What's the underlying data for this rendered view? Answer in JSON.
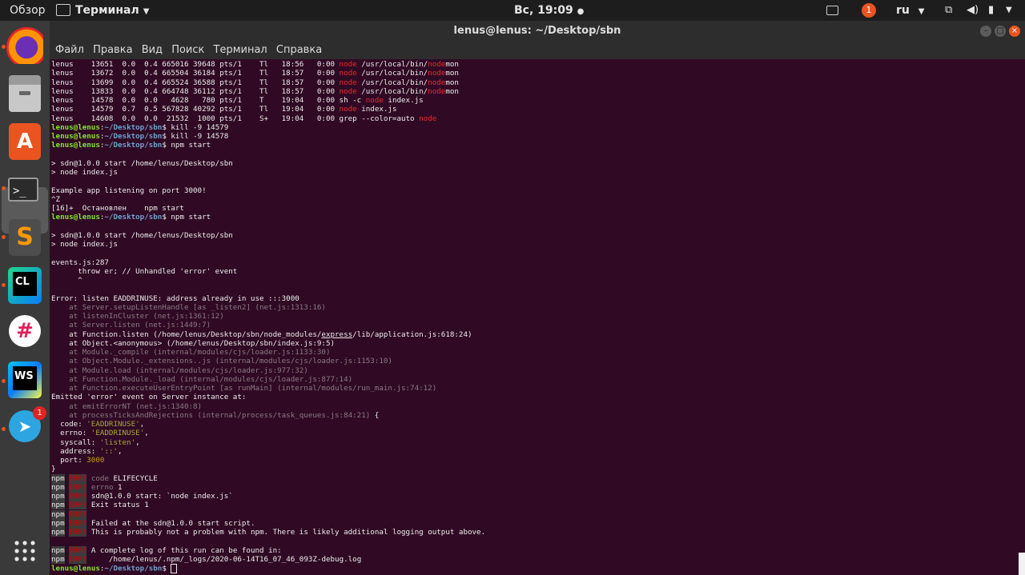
{
  "topbar": {
    "activities": "Обзор",
    "app_menu": "Терминал",
    "clock": "Вс, 19:09",
    "language": "ru"
  },
  "dock": {
    "apps": [
      {
        "name": "firefox-icon",
        "running": true
      },
      {
        "name": "files-icon",
        "running": false
      },
      {
        "name": "software-center-icon",
        "running": false
      },
      {
        "name": "terminal-icon",
        "running": true
      },
      {
        "name": "sublime-text-icon",
        "running": true
      },
      {
        "name": "clion-icon",
        "running": true
      },
      {
        "name": "slack-icon",
        "running": false
      },
      {
        "name": "webstorm-icon",
        "running": true
      },
      {
        "name": "telegram-icon",
        "running": true,
        "badge": "1"
      }
    ],
    "show_apps": "show-applications-icon"
  },
  "window": {
    "title": "lenus@lenus: ~/Desktop/sbn",
    "menu": [
      "Файл",
      "Правка",
      "Вид",
      "Поиск",
      "Терминал",
      "Справка"
    ]
  },
  "terminal": {
    "lines": [
      [
        {
          "t": "lenus    13651  0.0  0.4 665016 39648 pts/1    Tl   18:56   0:00 "
        },
        {
          "t": "node",
          "c": "red"
        },
        {
          "t": " /usr/local/bin/"
        },
        {
          "t": "node",
          "c": "red"
        },
        {
          "t": "mon"
        }
      ],
      [
        {
          "t": "lenus    13672  0.0  0.4 665504 36184 pts/1    Tl   18:57   0:00 "
        },
        {
          "t": "node",
          "c": "red"
        },
        {
          "t": " /usr/local/bin/"
        },
        {
          "t": "node",
          "c": "red"
        },
        {
          "t": "mon"
        }
      ],
      [
        {
          "t": "lenus    13699  0.0  0.4 665524 36588 pts/1    Tl   18:57   0:00 "
        },
        {
          "t": "node",
          "c": "red"
        },
        {
          "t": " /usr/local/bin/"
        },
        {
          "t": "node",
          "c": "red"
        },
        {
          "t": "mon"
        }
      ],
      [
        {
          "t": "lenus    13833  0.0  0.4 664748 36112 pts/1    Tl   18:57   0:00 "
        },
        {
          "t": "node",
          "c": "red"
        },
        {
          "t": " /usr/local/bin/"
        },
        {
          "t": "node",
          "c": "red"
        },
        {
          "t": "mon"
        }
      ],
      [
        {
          "t": "lenus    14578  0.0  0.0   4628   780 pts/1    T    19:04   0:00 sh -c "
        },
        {
          "t": "node",
          "c": "red"
        },
        {
          "t": " index.js"
        }
      ],
      [
        {
          "t": "lenus    14579  0.7  0.5 567828 40292 pts/1    Tl   19:04   0:00 "
        },
        {
          "t": "node",
          "c": "red"
        },
        {
          "t": " index.js"
        }
      ],
      [
        {
          "t": "lenus    14608  0.0  0.0  21532  1000 pts/1    S+   19:04   0:00 grep --color=auto "
        },
        {
          "t": "node",
          "c": "red"
        }
      ],
      [
        {
          "t": "lenus@lenus",
          "c": "prompt"
        },
        {
          "t": ":"
        },
        {
          "t": "~/Desktop/sbn",
          "c": "path"
        },
        {
          "t": "$ kill -9 14579"
        }
      ],
      [
        {
          "t": "lenus@lenus",
          "c": "prompt"
        },
        {
          "t": ":"
        },
        {
          "t": "~/Desktop/sbn",
          "c": "path"
        },
        {
          "t": "$ kill -9 14578"
        }
      ],
      [
        {
          "t": "lenus@lenus",
          "c": "prompt"
        },
        {
          "t": ":"
        },
        {
          "t": "~/Desktop/sbn",
          "c": "path"
        },
        {
          "t": "$ npm start"
        }
      ],
      [
        {
          "t": ""
        }
      ],
      [
        {
          "t": "> sdn@1.0.0 start /home/lenus/Desktop/sbn"
        }
      ],
      [
        {
          "t": "> node index.js"
        }
      ],
      [
        {
          "t": ""
        }
      ],
      [
        {
          "t": "Example app listening on port 3000!"
        }
      ],
      [
        {
          "t": "^Z"
        }
      ],
      [
        {
          "t": "[16]+  Остановлен    npm start"
        }
      ],
      [
        {
          "t": "lenus@lenus",
          "c": "prompt"
        },
        {
          "t": ":"
        },
        {
          "t": "~/Desktop/sbn",
          "c": "path"
        },
        {
          "t": "$ npm start"
        }
      ],
      [
        {
          "t": ""
        }
      ],
      [
        {
          "t": "> sdn@1.0.0 start /home/lenus/Desktop/sbn"
        }
      ],
      [
        {
          "t": "> node index.js"
        }
      ],
      [
        {
          "t": ""
        }
      ],
      [
        {
          "t": "events.js:287"
        }
      ],
      [
        {
          "t": "      throw er; // Unhandled 'error' event"
        }
      ],
      [
        {
          "t": "      ^"
        }
      ],
      [
        {
          "t": ""
        }
      ],
      [
        {
          "t": "Error: listen EADDRINUSE: address already in use :::3000"
        }
      ],
      [
        {
          "t": "    at Server.setupListenHandle [as _listen2] (net.js:1313:16)",
          "c": "dim"
        }
      ],
      [
        {
          "t": "    at listenInCluster (net.js:1361:12)",
          "c": "dim"
        }
      ],
      [
        {
          "t": "    at Server.listen (net.js:1449:7)",
          "c": "dim"
        }
      ],
      [
        {
          "t": "    at Function.listen (/home/lenus/Desktop/sbn/node_modules/"
        },
        {
          "t": "express",
          "c": "u"
        },
        {
          "t": "/lib/application.js:618:24)"
        }
      ],
      [
        {
          "t": "    at Object.<anonymous> (/home/lenus/Desktop/sbn/index.js:9:5)"
        }
      ],
      [
        {
          "t": "    at Module._compile (internal/modules/cjs/loader.js:1133:30)",
          "c": "dim"
        }
      ],
      [
        {
          "t": "    at Object.Module._extensions..js (internal/modules/cjs/loader.js:1153:10)",
          "c": "dim"
        }
      ],
      [
        {
          "t": "    at Module.load (internal/modules/cjs/loader.js:977:32)",
          "c": "dim"
        }
      ],
      [
        {
          "t": "    at Function.Module._load (internal/modules/cjs/loader.js:877:14)",
          "c": "dim"
        }
      ],
      [
        {
          "t": "    at Function.executeUserEntryPoint [as runMain] (internal/modules/run_main.js:74:12)",
          "c": "dim"
        }
      ],
      [
        {
          "t": "Emitted 'error' event on Server instance at:"
        }
      ],
      [
        {
          "t": "    at emitErrorNT (net.js:1340:8)",
          "c": "dim"
        }
      ],
      [
        {
          "t": "    at processTicksAndRejections (internal/process/task_queues.js:84:21)",
          "c": "dim"
        },
        {
          "t": " {"
        }
      ],
      [
        {
          "t": "  code: "
        },
        {
          "t": "'EADDRINUSE'",
          "c": "green"
        },
        {
          "t": ","
        }
      ],
      [
        {
          "t": "  errno: "
        },
        {
          "t": "'EADDRINUSE'",
          "c": "green"
        },
        {
          "t": ","
        }
      ],
      [
        {
          "t": "  syscall: "
        },
        {
          "t": "'listen'",
          "c": "green"
        },
        {
          "t": ","
        }
      ],
      [
        {
          "t": "  address: "
        },
        {
          "t": "'::'",
          "c": "green"
        },
        {
          "t": ","
        }
      ],
      [
        {
          "t": "  port: "
        },
        {
          "t": "3000",
          "c": "yellow"
        }
      ],
      [
        {
          "t": "}"
        }
      ],
      [
        {
          "t": "npm",
          "c": "npm"
        },
        {
          "t": " "
        },
        {
          "t": "ERR!",
          "c": "err"
        },
        {
          "t": " "
        },
        {
          "t": "code",
          "c": "dim"
        },
        {
          "t": " ELIFECYCLE"
        }
      ],
      [
        {
          "t": "npm",
          "c": "npm"
        },
        {
          "t": " "
        },
        {
          "t": "ERR!",
          "c": "err"
        },
        {
          "t": " "
        },
        {
          "t": "errno",
          "c": "dim"
        },
        {
          "t": " 1"
        }
      ],
      [
        {
          "t": "npm",
          "c": "npm"
        },
        {
          "t": " "
        },
        {
          "t": "ERR!",
          "c": "err"
        },
        {
          "t": " sdn@1.0.0 start: `node index.js`"
        }
      ],
      [
        {
          "t": "npm",
          "c": "npm"
        },
        {
          "t": " "
        },
        {
          "t": "ERR!",
          "c": "err"
        },
        {
          "t": " Exit status 1"
        }
      ],
      [
        {
          "t": "npm",
          "c": "npm"
        },
        {
          "t": " "
        },
        {
          "t": "ERR!",
          "c": "err"
        }
      ],
      [
        {
          "t": "npm",
          "c": "npm"
        },
        {
          "t": " "
        },
        {
          "t": "ERR!",
          "c": "err"
        },
        {
          "t": " Failed at the sdn@1.0.0 start script."
        }
      ],
      [
        {
          "t": "npm",
          "c": "npm"
        },
        {
          "t": " "
        },
        {
          "t": "ERR!",
          "c": "err"
        },
        {
          "t": " This is probably not a problem with npm. There is likely additional logging output above."
        }
      ],
      [
        {
          "t": ""
        }
      ],
      [
        {
          "t": "npm",
          "c": "npm"
        },
        {
          "t": " "
        },
        {
          "t": "ERR!",
          "c": "err"
        },
        {
          "t": " A complete log of this run can be found in:"
        }
      ],
      [
        {
          "t": "npm",
          "c": "npm"
        },
        {
          "t": " "
        },
        {
          "t": "ERR!",
          "c": "err"
        },
        {
          "t": "     /home/lenus/.npm/_logs/2020-06-14T16_07_46_093Z-debug.log"
        }
      ],
      [
        {
          "t": "lenus@lenus",
          "c": "prompt"
        },
        {
          "t": ":"
        },
        {
          "t": "~/Desktop/sbn",
          "c": "path"
        },
        {
          "t": "$ "
        },
        {
          "t": "",
          "c": "cursor"
        }
      ]
    ]
  }
}
